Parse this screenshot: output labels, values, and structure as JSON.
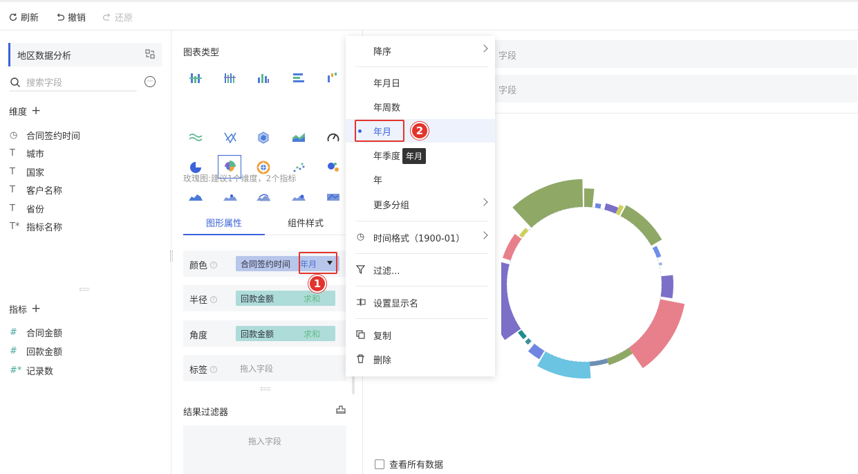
{
  "toolbar": {
    "refresh": "刷新",
    "undo": "撤销",
    "redo": "还原"
  },
  "left": {
    "dataset_name": "地区数据分析",
    "search_placeholder": "搜索字段",
    "dimension_title": "维度",
    "dimensions": [
      {
        "icon": "clock-icon",
        "glyph": "◷",
        "label": "合同签约时间"
      },
      {
        "icon": "text-field-icon",
        "glyph": "T",
        "label": "城市"
      },
      {
        "icon": "text-field-icon",
        "glyph": "T",
        "label": "国家"
      },
      {
        "icon": "text-field-icon",
        "glyph": "T",
        "label": "客户名称"
      },
      {
        "icon": "text-field-icon",
        "glyph": "T",
        "label": "省份"
      },
      {
        "icon": "calc-text-field-icon",
        "glyph": "T*",
        "label": "指标名称"
      }
    ],
    "measure_title": "指标",
    "measures": [
      {
        "icon": "number-field-icon",
        "glyph": "#",
        "label": "合同金额"
      },
      {
        "icon": "number-field-icon",
        "glyph": "#",
        "label": "回款金额"
      },
      {
        "icon": "calc-number-field-icon",
        "glyph": "#*",
        "label": "记录数"
      }
    ]
  },
  "middle": {
    "chart_type_title": "图表类型",
    "rose_hint": "玫瑰图:建议1个维度，2个指标",
    "tab_shape": "图形属性",
    "tab_style": "组件样式",
    "props": {
      "color_label": "颜色",
      "color_field": "合同签约时间",
      "color_agg": "年月",
      "radius_label": "半径",
      "radius_field": "回款金额",
      "radius_agg": "求和",
      "angle_label": "角度",
      "angle_field": "回款金额",
      "angle_agg": "求和",
      "tag_label": "标签",
      "tag_placeholder": "拖入字段"
    },
    "filter_title": "结果过滤器",
    "filter_placeholder": "拖入字段"
  },
  "canvas": {
    "drop_hint_1": "字段",
    "drop_hint_2": "字段",
    "see_all_label": "查看所有数据"
  },
  "menu": {
    "sort_desc": "降序",
    "ymd": "年月日",
    "year_week": "年周数",
    "year_month": "年月",
    "year_quarter": "年季度",
    "year": "年",
    "more_group": "更多分组",
    "time_format": "时间格式（1900-01）",
    "filter": "过滤...",
    "set_display_name": "设置显示名",
    "copy": "复制",
    "delete": "删除"
  },
  "tooltip": "年月",
  "callouts": {
    "first": "1",
    "second": "2"
  },
  "colors": {
    "accent": "#3a62d9",
    "callout": "#e2342d"
  },
  "chart_data": {
    "type": "pie",
    "subtype": "rose-ring",
    "segments": [
      {
        "start": 0,
        "end": 6,
        "color": "#8fa866"
      },
      {
        "start": 8,
        "end": 12,
        "color": "#6f86e0"
      },
      {
        "start": 15,
        "end": 24,
        "color": "#7b6fc8"
      },
      {
        "start": 24,
        "end": 27,
        "color": "#cfd05b"
      },
      {
        "start": 28,
        "end": 60,
        "color": "#8fa866"
      },
      {
        "start": 62,
        "end": 70,
        "color": "#6f8fe8"
      },
      {
        "start": 74,
        "end": 76,
        "color": "#9bb5e6"
      },
      {
        "start": 84,
        "end": 99,
        "color": "#7b6fc8"
      },
      {
        "start": 101,
        "end": 145,
        "color": "#e8808b"
      },
      {
        "start": 145,
        "end": 163,
        "color": "#8fa866"
      },
      {
        "start": 163,
        "end": 176,
        "color": "#6d8fb3"
      },
      {
        "start": 176,
        "end": 210,
        "color": "#6ac4e2"
      },
      {
        "start": 211,
        "end": 220,
        "color": "#6f86e0"
      },
      {
        "start": 223,
        "end": 226,
        "color": "#3a8f9a"
      },
      {
        "start": 228,
        "end": 234,
        "color": "#1f8c8c"
      },
      {
        "start": 235,
        "end": 285,
        "color": "#7b6fc8"
      },
      {
        "start": 288,
        "end": 306,
        "color": "#e8808b"
      },
      {
        "start": 307,
        "end": 314,
        "color": "#cfd05b"
      },
      {
        "start": 317,
        "end": 359,
        "color": "#8fa866"
      }
    ],
    "outer_scale": [
      0.34,
      0.05,
      0.09,
      0.16,
      0.21,
      0.05,
      0.02,
      0.2,
      0.47,
      0.1,
      0.05,
      0.3,
      0.16,
      0.06,
      0.05,
      0.36,
      0.13,
      0.04,
      0.53
    ]
  }
}
